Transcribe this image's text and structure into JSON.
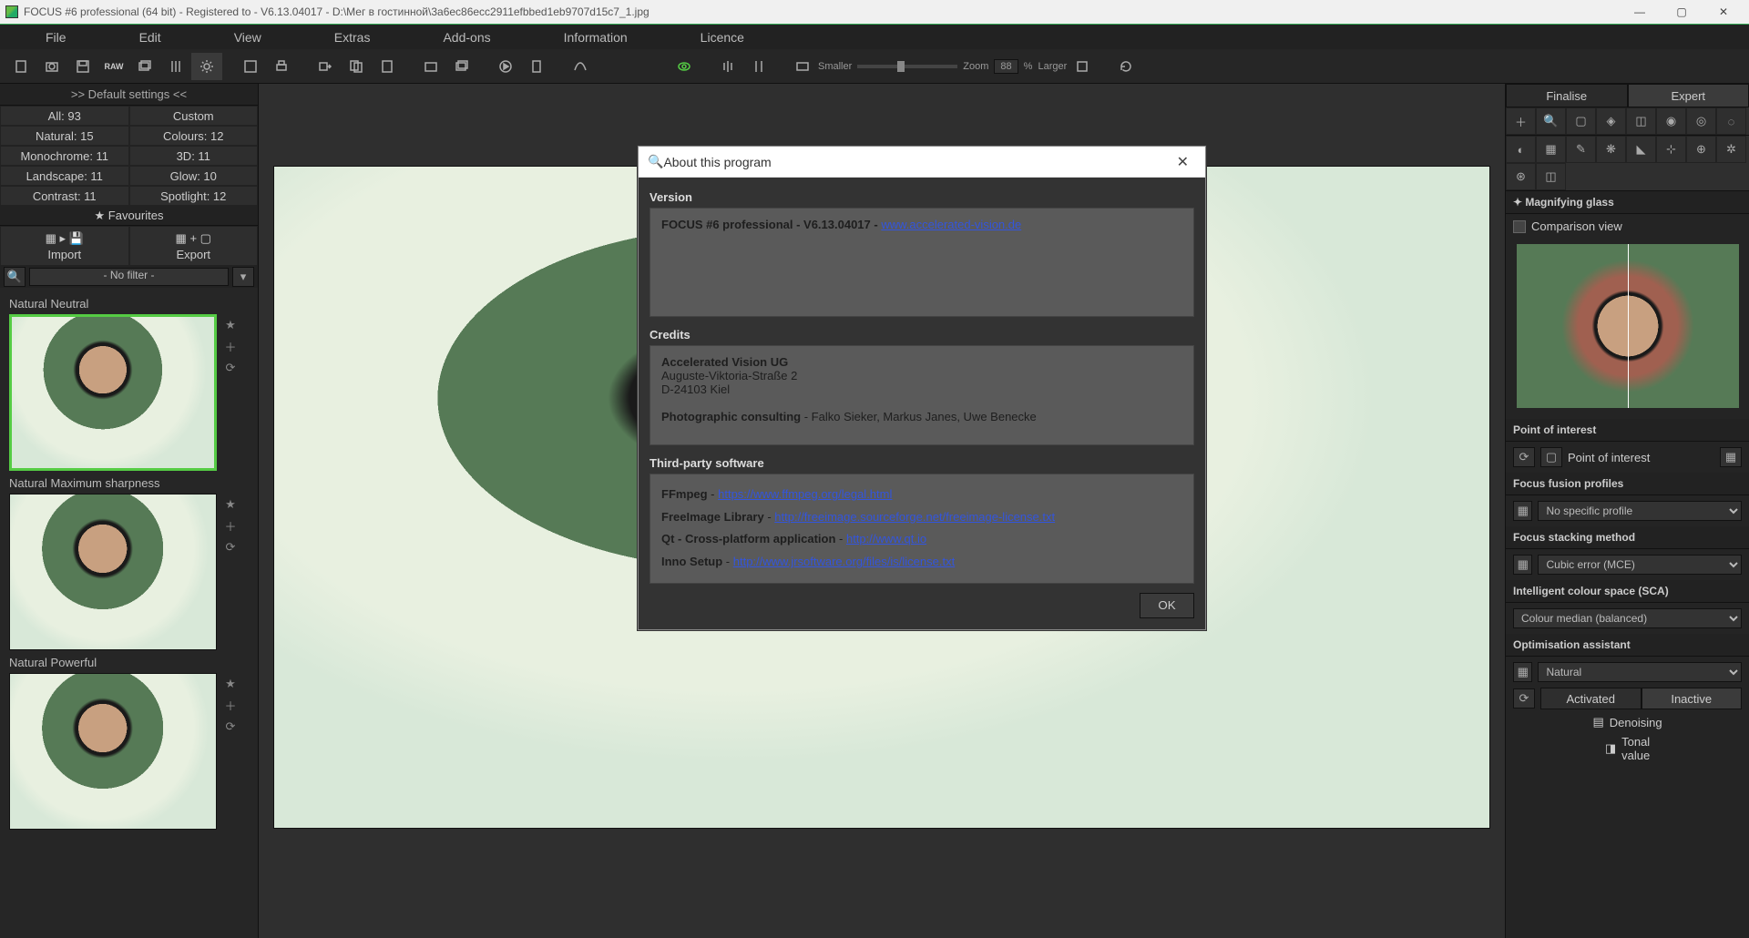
{
  "window": {
    "title": "FOCUS #6 professional (64 bit) - Registered to - V6.13.04017 - D:\\Мег в гостинной\\3a6ec86ecc2911efbbed1eb9707d15c7_1.jpg"
  },
  "menu": [
    "File",
    "Edit",
    "View",
    "Extras",
    "Add-ons",
    "Information",
    "Licence"
  ],
  "toolbar": {
    "zoom_label": "Zoom",
    "zoom_value": "88",
    "zoom_pct": "%",
    "smaller": "Smaller",
    "larger": "Larger"
  },
  "left": {
    "default_settings": ">> Default settings <<",
    "categories": {
      "all": "All: 93",
      "custom": "Custom",
      "natural": "Natural: 15",
      "colours": "Colours: 12",
      "monochrome": "Monochrome: 11",
      "threed": "3D: 11",
      "landscape": "Landscape: 11",
      "glow": "Glow: 10",
      "contrast": "Contrast: 11",
      "spotlight": "Spotlight: 12"
    },
    "favourites": "★ Favourites",
    "import": "Import",
    "export": "Export",
    "filter_select": "- No filter -",
    "presets": [
      "Natural Neutral",
      "Natural Maximum sharpness",
      "Natural Powerful"
    ]
  },
  "right": {
    "tabs": {
      "finalise": "Finalise",
      "expert": "Expert"
    },
    "magnifying": "Magnifying glass",
    "comparison": "Comparison view",
    "poi_head": "Point of interest",
    "poi_label": "Point of interest",
    "profiles_head": "Focus fusion profiles",
    "profiles_value": "No specific profile",
    "stacking_head": "Focus stacking method",
    "stacking_value": "Cubic error (MCE)",
    "sca_head": "Intelligent colour space (SCA)",
    "sca_value": "Colour median (balanced)",
    "opt_head": "Optimisation assistant",
    "opt_value": "Natural",
    "activated": "Activated",
    "inactive": "Inactive",
    "denoising": "Denoising",
    "tonal": "Tonal value"
  },
  "dialog": {
    "title": "About this program",
    "version_head": "Version",
    "version_text_a": "FOCUS #6 professional - V6.13.04017 - ",
    "version_link": "www.accelerated-vision.de",
    "credits_head": "Credits",
    "credits_company": "Accelerated Vision UG",
    "credits_addr1": "Auguste-Viktoria-Straße 2",
    "credits_addr2": "D-24103 Kiel",
    "credits_consulting_label": "Photographic consulting",
    "credits_consulting_text": " - Falko Sieker, Markus Janes, Uwe Benecke",
    "thirdparty_head": "Third-party software",
    "tp": [
      {
        "name": "FFmpeg",
        "sep": " - ",
        "url": "https://www.ffmpeg.org/legal.html"
      },
      {
        "name": "FreeImage Library",
        "sep": " - ",
        "url": "http://freeimage.sourceforge.net/freeimage-license.txt"
      },
      {
        "name": "Qt - Cross-platform application",
        "sep": " - ",
        "url": "http://www.qt.io"
      },
      {
        "name": "Inno Setup",
        "sep": " - ",
        "url": "http://www.jrsoftware.org/files/is/license.txt"
      }
    ],
    "ok": "OK"
  }
}
